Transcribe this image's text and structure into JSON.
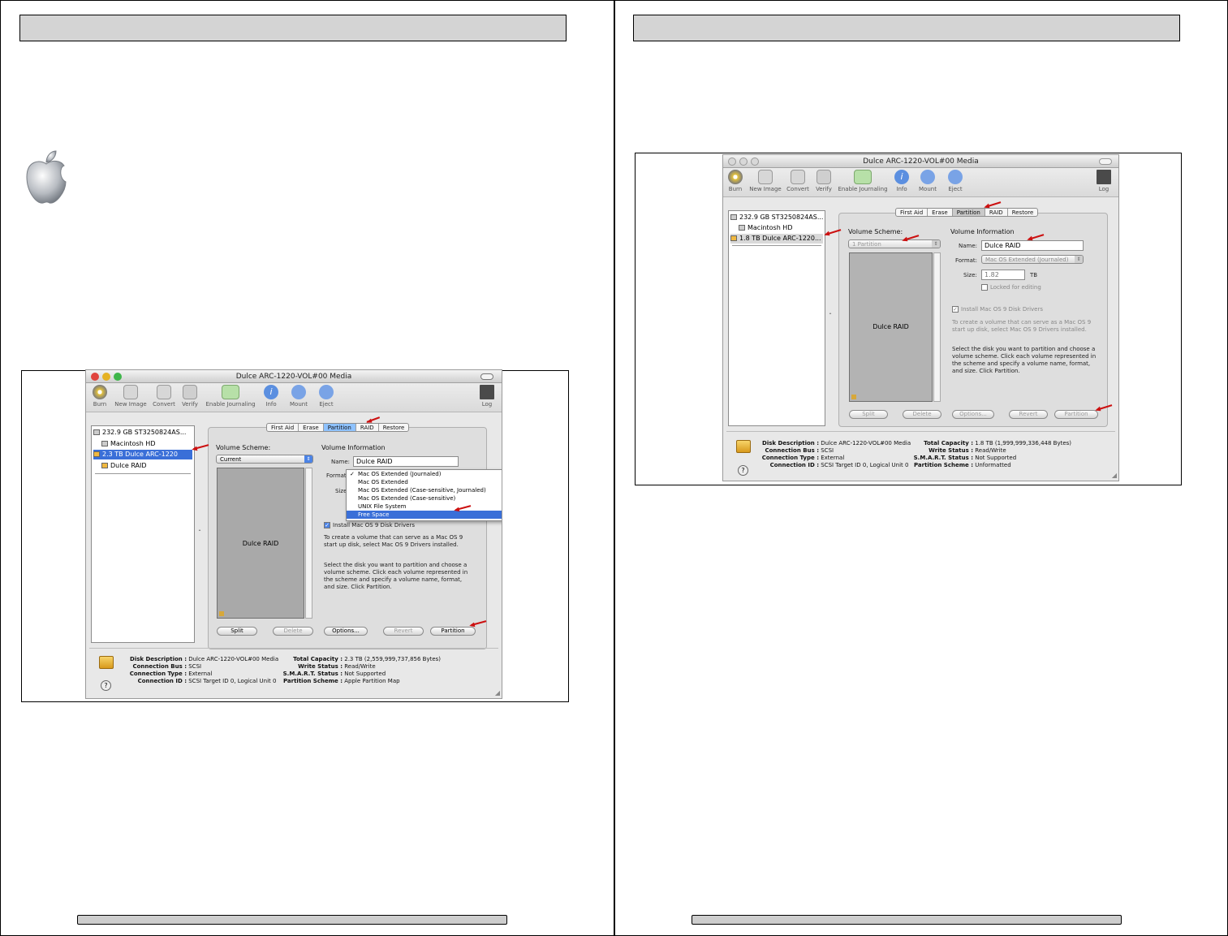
{
  "left_window": {
    "title": "Dulce ARC-1220-VOL#00 Media",
    "toolbar": [
      "Burn",
      "New Image",
      "Convert",
      "Verify",
      "Enable Journaling",
      "Info",
      "Mount",
      "Eject"
    ],
    "toolbar_right": "Log",
    "sidebar": [
      "232.9 GB ST3250824AS...",
      "Macintosh HD",
      "2.3 TB Dulce ARC-1220",
      "Dulce RAID"
    ],
    "tabs": [
      "First Aid",
      "Erase",
      "Partition",
      "RAID",
      "Restore"
    ],
    "active_tab": "Partition",
    "volume_scheme_label": "Volume Scheme:",
    "volume_scheme_value": "Current",
    "volume_info_label": "Volume Information",
    "name_label": "Name:",
    "name_value": "Dulce RAID",
    "format_label": "Format",
    "size_label": "Size",
    "format_menu": [
      "Mac OS Extended (Journaled)",
      "Mac OS Extended",
      "Mac OS Extended (Case-sensitive, Journaled)",
      "Mac OS Extended (Case-sensitive)",
      "UNIX File System",
      "Free Space"
    ],
    "format_checked": "Mac OS Extended (Journaled)",
    "format_highlighted": "Free Space",
    "install_drivers": "Install Mac OS 9 Disk Drivers",
    "help_text_1": [
      "To create a volume that can serve as a Mac OS 9",
      "start up disk, select Mac OS 9 Drivers installed."
    ],
    "help_text_2": [
      "Select the disk you want to partition and choose a",
      "volume scheme. Click each volume represented in",
      "the scheme and specify a volume name, format,",
      "and size. Click Partition."
    ],
    "volume_box_label": "Dulce RAID",
    "buttons": [
      "Split",
      "Delete",
      "Options...",
      "Revert",
      "Partition"
    ],
    "disk_info_left": [
      [
        "Disk Description :",
        "Dulce ARC-1220-VOL#00 Media"
      ],
      [
        "Connection Bus :",
        "SCSI"
      ],
      [
        "Connection Type :",
        "External"
      ],
      [
        "Connection ID :",
        "SCSI Target ID 0, Logical Unit 0"
      ]
    ],
    "disk_info_right": [
      [
        "Total Capacity :",
        "2.3 TB (2,559,999,737,856 Bytes)"
      ],
      [
        "Write Status :",
        "Read/Write"
      ],
      [
        "S.M.A.R.T. Status :",
        "Not Supported"
      ],
      [
        "Partition Scheme :",
        "Apple Partition Map"
      ]
    ],
    "help_button": "?"
  },
  "right_window": {
    "title": "Dulce ARC-1220-VOL#00 Media",
    "toolbar": [
      "Burn",
      "New Image",
      "Convert",
      "Verify",
      "Enable Journaling",
      "Info",
      "Mount",
      "Eject"
    ],
    "toolbar_right": "Log",
    "sidebar": [
      "232.9 GB ST3250824AS...",
      "Macintosh HD",
      "1.8 TB Dulce ARC-1220..."
    ],
    "tabs": [
      "First Aid",
      "Erase",
      "Partition",
      "RAID",
      "Restore"
    ],
    "active_tab": "Partition",
    "volume_scheme_label": "Volume Scheme:",
    "volume_scheme_value": "1 Partition",
    "volume_info_label": "Volume Information",
    "name_label": "Name:",
    "name_value": "Dulce RAID",
    "format_label": "Format:",
    "format_value": "Mac OS Extended (Journaled)",
    "size_label": "Size:",
    "size_value": "1.82",
    "size_unit": "TB",
    "locked_label": "Locked for editing",
    "install_drivers": "Install Mac OS 9 Disk Drivers",
    "help_text_1": [
      "To create a volume that can serve as a Mac OS 9",
      "start up disk, select Mac OS 9 Drivers installed."
    ],
    "help_text_2": [
      "Select the disk you want to partition and choose a",
      "volume scheme. Click each volume represented in",
      "the scheme and specify a volume name, format,",
      "and size. Click Partition."
    ],
    "volume_box_label": "Dulce RAID",
    "buttons": [
      "Split",
      "Delete",
      "Options...",
      "Revert",
      "Partition"
    ],
    "disk_info_left": [
      [
        "Disk Description :",
        "Dulce ARC-1220-VOL#00 Media"
      ],
      [
        "Connection Bus :",
        "SCSI"
      ],
      [
        "Connection Type :",
        "External"
      ],
      [
        "Connection ID :",
        "SCSI Target ID 0, Logical Unit 0"
      ]
    ],
    "disk_info_right": [
      [
        "Total Capacity :",
        "1.8 TB (1,999,999,336,448 Bytes)"
      ],
      [
        "Write Status :",
        "Read/Write"
      ],
      [
        "S.M.A.R.T. Status :",
        "Not Supported"
      ],
      [
        "Partition Scheme :",
        "Unformatted"
      ]
    ],
    "help_button": "?"
  },
  "colors": {
    "selection": "#3a6fd8",
    "header_bar": "#d4d4d4",
    "arrow": "#cc1111"
  }
}
